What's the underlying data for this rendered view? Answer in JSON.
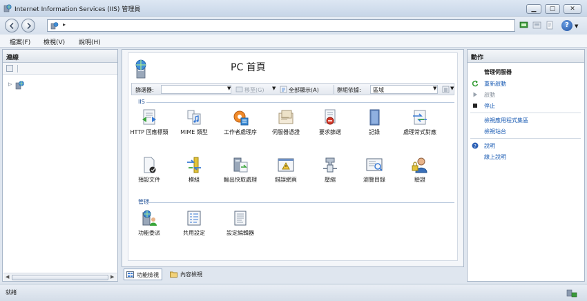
{
  "window": {
    "title": "Internet Information Services (IIS) 管理員"
  },
  "address": {
    "segment_arrow": "▸"
  },
  "menu": {
    "items": [
      "檔案(F)",
      "檢視(V)",
      "說明(H)"
    ]
  },
  "connections": {
    "title": "連線"
  },
  "center": {
    "title": "PC 首頁",
    "filter_label": "篩選器:",
    "go_label": "移至(G)",
    "show_all_label": "全部顯示(A)",
    "group_by_label": "群組依據:",
    "group_by_value": "區域",
    "groups": [
      {
        "name": "IIS",
        "features": [
          {
            "label": "HTTP 回應標頭",
            "icon": "http-headers-icon"
          },
          {
            "label": "MIME 類型",
            "icon": "mime-types-icon"
          },
          {
            "label": "工作者處理序",
            "icon": "worker-processes-icon"
          },
          {
            "label": "伺服器憑證",
            "icon": "server-certificates-icon"
          },
          {
            "label": "要求篩選",
            "icon": "request-filtering-icon"
          },
          {
            "label": "記錄",
            "icon": "logging-icon"
          },
          {
            "label": "處理常式對應",
            "icon": "handler-mappings-icon"
          },
          {
            "label": "預設文件",
            "icon": "default-document-icon"
          },
          {
            "label": "模組",
            "icon": "modules-icon"
          },
          {
            "label": "輸出快取處理",
            "icon": "output-caching-icon"
          },
          {
            "label": "錯誤網頁",
            "icon": "error-pages-icon"
          },
          {
            "label": "壓縮",
            "icon": "compression-icon"
          },
          {
            "label": "瀏覽目錄",
            "icon": "directory-browsing-icon"
          },
          {
            "label": "驗證",
            "icon": "authentication-icon"
          }
        ]
      },
      {
        "name": "管理",
        "features": [
          {
            "label": "功能委派",
            "icon": "feature-delegation-icon"
          },
          {
            "label": "共用設定",
            "icon": "shared-configuration-icon"
          },
          {
            "label": "設定編輯器",
            "icon": "configuration-editor-icon"
          }
        ]
      }
    ]
  },
  "view_tabs": {
    "features": "功能檢視",
    "content": "內容檢視"
  },
  "actions": {
    "title": "動作",
    "manage_server": "管理伺服器",
    "restart": "重新啟動",
    "start": "啟動",
    "stop": "停止",
    "view_app_pools": "檢視應用程式集區",
    "view_sites": "檢視站台",
    "help": "說明",
    "online_help": "線上說明"
  },
  "status": {
    "text": "就緒"
  },
  "colors": {
    "link": "#1f5fb5",
    "group_header": "#1f4f96"
  }
}
